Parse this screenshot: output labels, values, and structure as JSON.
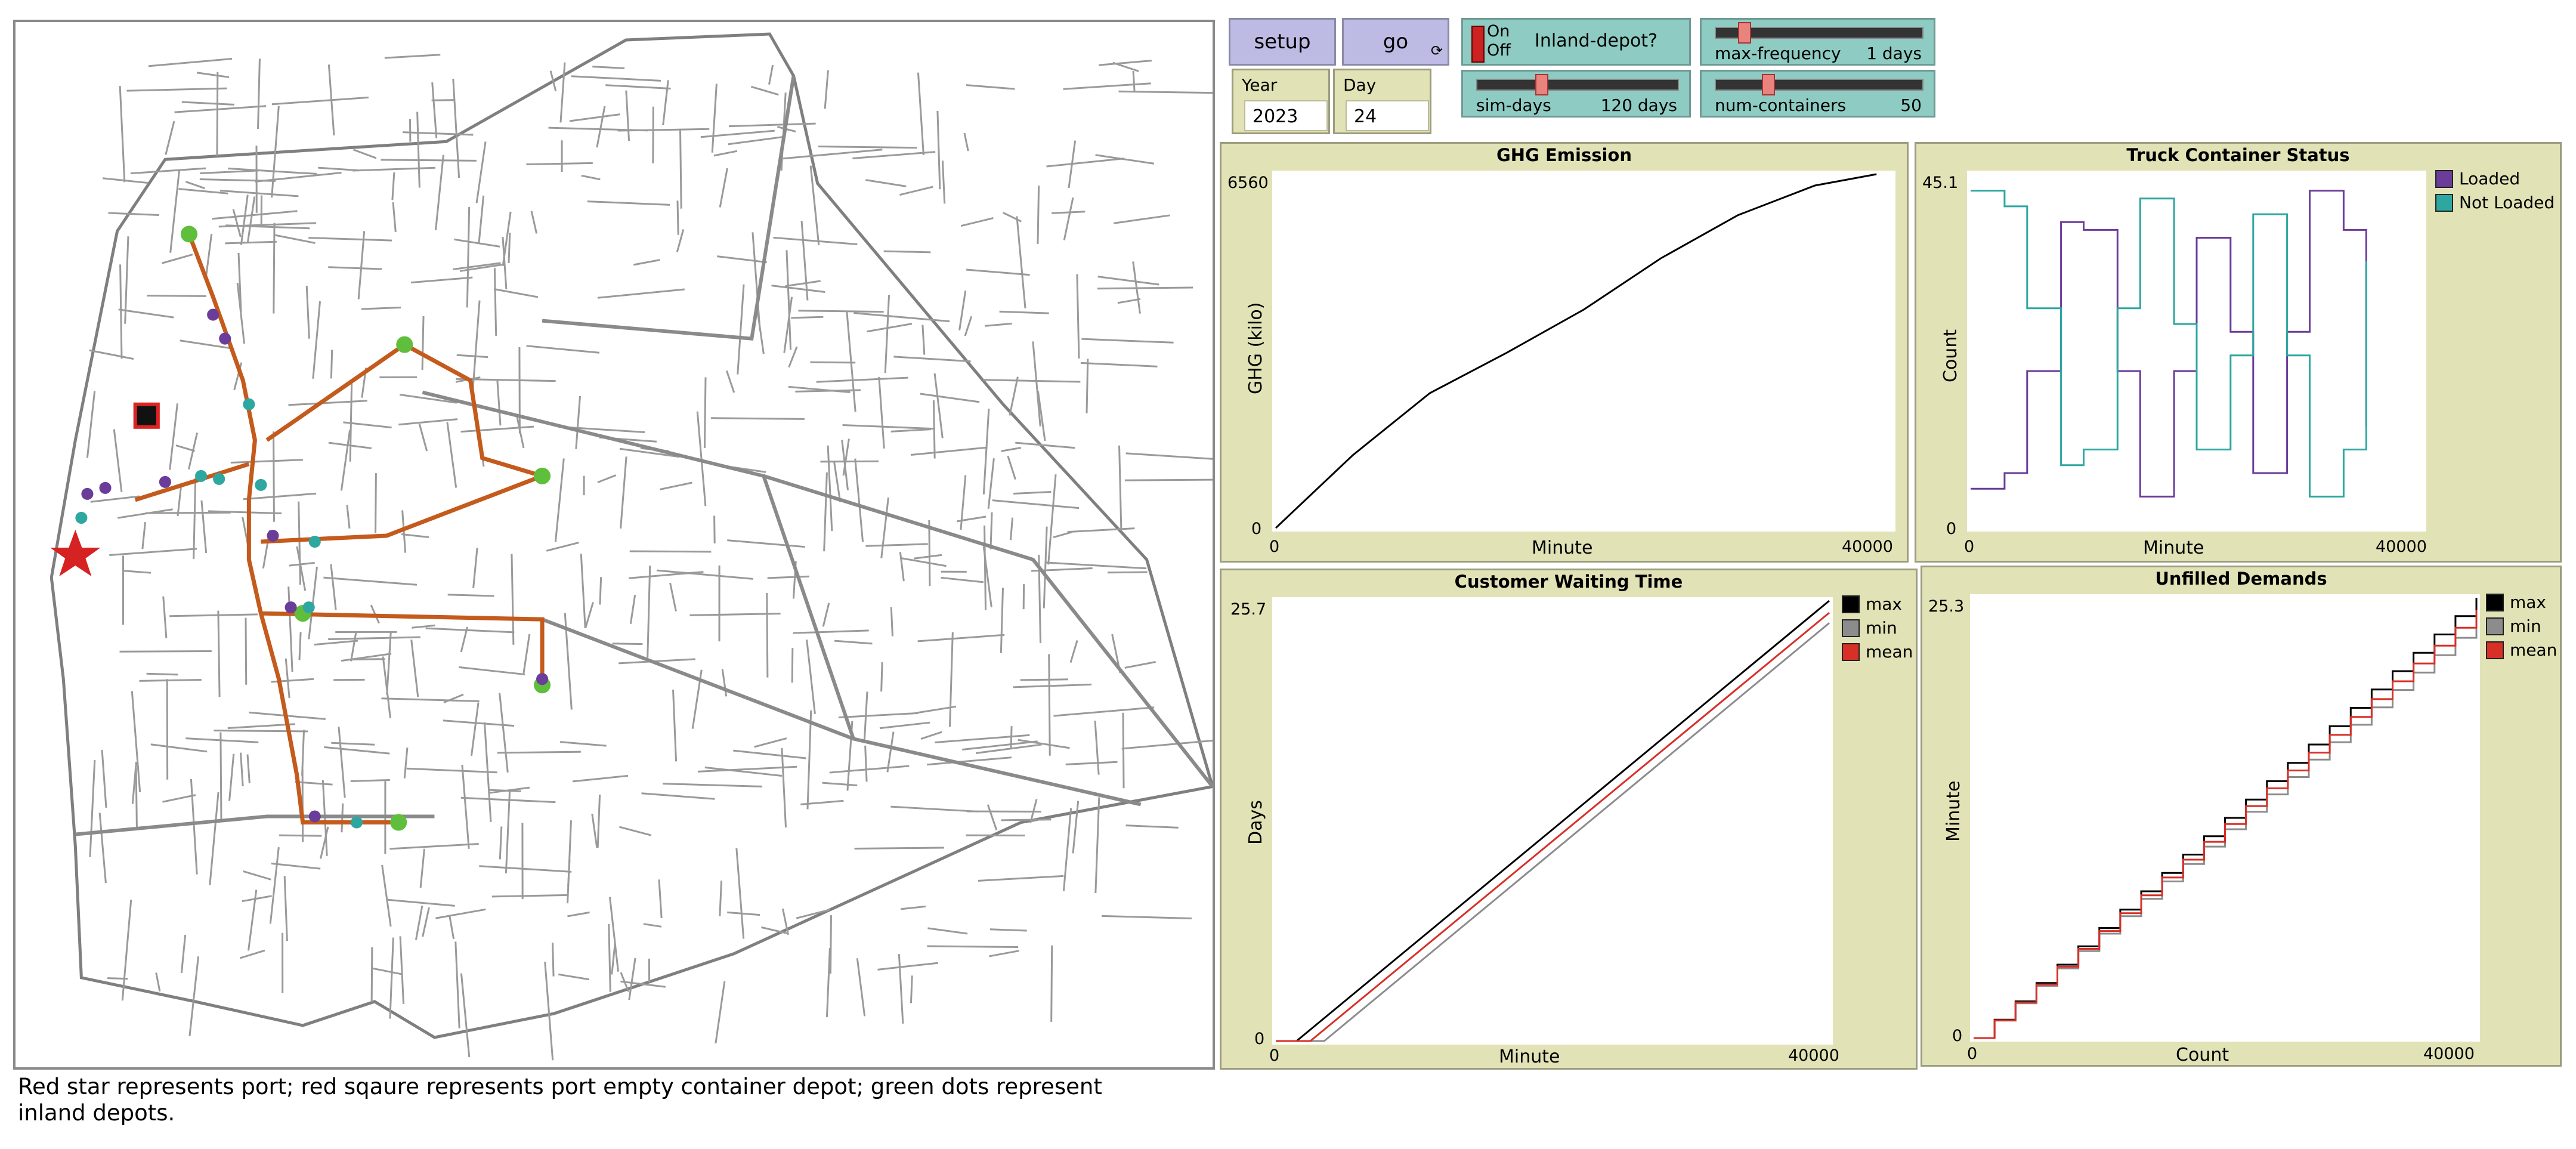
{
  "buttons": {
    "setup": "setup",
    "go": "go"
  },
  "monitors": [
    {
      "label": "Year",
      "value": "2023"
    },
    {
      "label": "Day",
      "value": "24"
    }
  ],
  "switch": {
    "on": "On",
    "off": "Off",
    "label": "Inland-depot?"
  },
  "sliders": [
    {
      "name": "max-frequency",
      "value": "1 days",
      "fraction": 0.12
    },
    {
      "name": "sim-days",
      "value": "120 days",
      "fraction": 0.31
    },
    {
      "name": "num-containers",
      "value": "50",
      "fraction": 0.24
    }
  ],
  "plots": {
    "ghg": {
      "title": "GHG Emission",
      "ylabel": "GHG (kilo)",
      "xlabel": "Minute",
      "ymax": "6560",
      "ymin": "0",
      "xmin": "0",
      "xmax": "40000"
    },
    "truck": {
      "title": "Truck Container Status",
      "ylabel": "Count",
      "xlabel": "Minute",
      "ymax": "45.1",
      "ymin": "0",
      "xmin": "0",
      "xmax": "40000",
      "legend": [
        {
          "name": "Loaded",
          "color": "#6a3d9a"
        },
        {
          "name": "Not Loaded",
          "color": "#2ea7a0"
        }
      ]
    },
    "waiting": {
      "title": "Customer Waiting Time",
      "ylabel": "Days",
      "xlabel": "Minute",
      "ymax": "25.7",
      "ymin": "0",
      "xmin": "0",
      "xmax": "40000",
      "legend": [
        {
          "name": "max",
          "color": "#000000"
        },
        {
          "name": "min",
          "color": "#8c8c8c"
        },
        {
          "name": "mean",
          "color": "#d73027"
        }
      ]
    },
    "unfilled": {
      "title": "Unfilled Demands",
      "ylabel": "Minute",
      "xlabel": "Count",
      "ymax": "25.3",
      "ymin": "0",
      "xmin": "0",
      "xmax": "40000",
      "legend": [
        {
          "name": "max",
          "color": "#000000"
        },
        {
          "name": "min",
          "color": "#8c8c8c"
        },
        {
          "name": "mean",
          "color": "#d73027"
        }
      ]
    }
  },
  "caption": "Red star represents port; red sqaure represents port empty container depot; green dots represent inland depots.",
  "chart_data": [
    {
      "type": "line",
      "title": "GHG Emission",
      "xlabel": "Minute",
      "ylabel": "GHG (kilo)",
      "xlim": [
        0,
        40000
      ],
      "ylim": [
        0,
        6560
      ],
      "series": [
        {
          "x": [
            0,
            5000,
            10000,
            15000,
            20000,
            25000,
            30000,
            35000,
            39000
          ],
          "values": [
            0,
            1350,
            2500,
            3250,
            4050,
            5000,
            5800,
            6350,
            6560
          ]
        }
      ]
    },
    {
      "type": "line",
      "title": "Truck Container Status",
      "xlabel": "Minute",
      "ylabel": "Count",
      "xlim": [
        0,
        40000
      ],
      "ylim": [
        0,
        45.1
      ],
      "series": [
        {
          "name": "Loaded",
          "x": [
            0,
            3000,
            5000,
            8000,
            10000,
            13000,
            15000,
            18000,
            20000,
            23000,
            25000,
            28000,
            30000,
            33000,
            35000
          ],
          "values": [
            5,
            7,
            20,
            39,
            38,
            20,
            4,
            20,
            37,
            25,
            7,
            25,
            43,
            38,
            13
          ]
        },
        {
          "name": "Not Loaded",
          "x": [
            0,
            3000,
            5000,
            8000,
            10000,
            13000,
            15000,
            18000,
            20000,
            23000,
            25000,
            28000,
            30000,
            33000,
            35000
          ],
          "values": [
            43,
            41,
            28,
            8,
            10,
            28,
            42,
            26,
            10,
            22,
            40,
            22,
            4,
            10,
            34
          ]
        }
      ]
    },
    {
      "type": "line",
      "title": "Customer Waiting Time",
      "xlabel": "Minute",
      "ylabel": "Days",
      "xlim": [
        0,
        40000
      ],
      "ylim": [
        0,
        25.7
      ],
      "series": [
        {
          "name": "max",
          "x": [
            0,
            1500,
            40000
          ],
          "values": [
            0,
            0,
            25.7
          ]
        },
        {
          "name": "min",
          "x": [
            0,
            3500,
            40000
          ],
          "values": [
            0,
            0,
            24.4
          ]
        },
        {
          "name": "mean",
          "x": [
            0,
            2500,
            40000
          ],
          "values": [
            0,
            0,
            25.0
          ]
        }
      ]
    },
    {
      "type": "line",
      "title": "Unfilled Demands",
      "xlabel": "Count",
      "ylabel": "Minute",
      "xlim": [
        0,
        40000
      ],
      "ylim": [
        0,
        25.3
      ],
      "series": [
        {
          "name": "max",
          "x": [
            0,
            40000
          ],
          "values": [
            0,
            25.3
          ]
        },
        {
          "name": "min",
          "x": [
            0,
            40000
          ],
          "values": [
            0,
            24.0
          ]
        },
        {
          "name": "mean",
          "x": [
            0,
            40000
          ],
          "values": [
            0,
            24.6
          ]
        }
      ]
    }
  ]
}
